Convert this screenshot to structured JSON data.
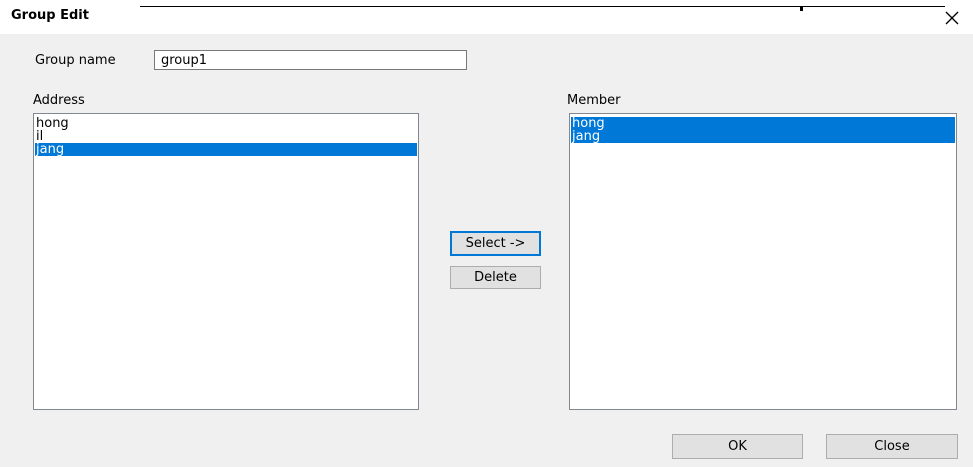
{
  "window": {
    "title": "Group Edit"
  },
  "group_name": {
    "label": "Group name",
    "value": "group1"
  },
  "address": {
    "label": "Address",
    "items": [
      {
        "text": "hong",
        "selected": false
      },
      {
        "text": "il",
        "selected": false
      },
      {
        "text": "jang",
        "selected": true
      }
    ]
  },
  "member": {
    "label": "Member",
    "items": [
      {
        "text": "hong",
        "selected": true
      },
      {
        "text": "jang",
        "selected": true
      }
    ]
  },
  "buttons": {
    "select": "Select ->",
    "delete": "Delete",
    "ok": "OK",
    "close": "Close"
  },
  "colors": {
    "selection": "#0078d7",
    "background": "#f0f0f0"
  }
}
